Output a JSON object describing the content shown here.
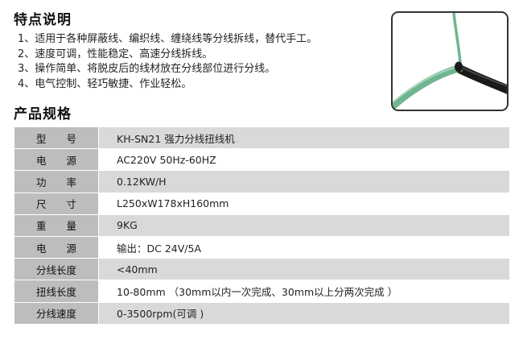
{
  "features": {
    "heading": "特点说明",
    "items": [
      "1、适用于各种屏蔽线、编织线、缠绕线等分线拆线，替代手工。",
      "2、速度可调，性能稳定、高速分线拆线。",
      "3、操作简单、将脱皮后的线材放在分线部位进行分线。",
      "4、电气控制、轻巧敏捷、作业轻松。"
    ]
  },
  "specs": {
    "heading": "产品规格",
    "rows": [
      {
        "label": "型　　号",
        "value": "KH-SN21 强力分线扭线机"
      },
      {
        "label": "电　　源",
        "value": "AC220V   50Hz-60HZ"
      },
      {
        "label": "功　　率",
        "value": "0.12KW/H"
      },
      {
        "label": "尺　　寸",
        "value": "L250xW178xH160mm"
      },
      {
        "label": "重　　量",
        "value": "9KG"
      },
      {
        "label": "电　　源",
        "value": "输出：DC 24V/5A"
      },
      {
        "label": "分线长度",
        "value": "<40mm"
      },
      {
        "label": "扭线长度",
        "value": "10-80mm （30mm以内一次完成、30mm以上分两次完成 ）"
      },
      {
        "label": "分线速度",
        "value": "0-3500rpm(可调 )"
      }
    ]
  },
  "colors": {
    "label_cell": "#bdbdbd",
    "value_cell_shaded": "#d9d9d9",
    "wire_green": "#6fb58f",
    "cable_black": "#1a1a1a"
  },
  "icons": {
    "photo": "wire-cable-photo"
  }
}
